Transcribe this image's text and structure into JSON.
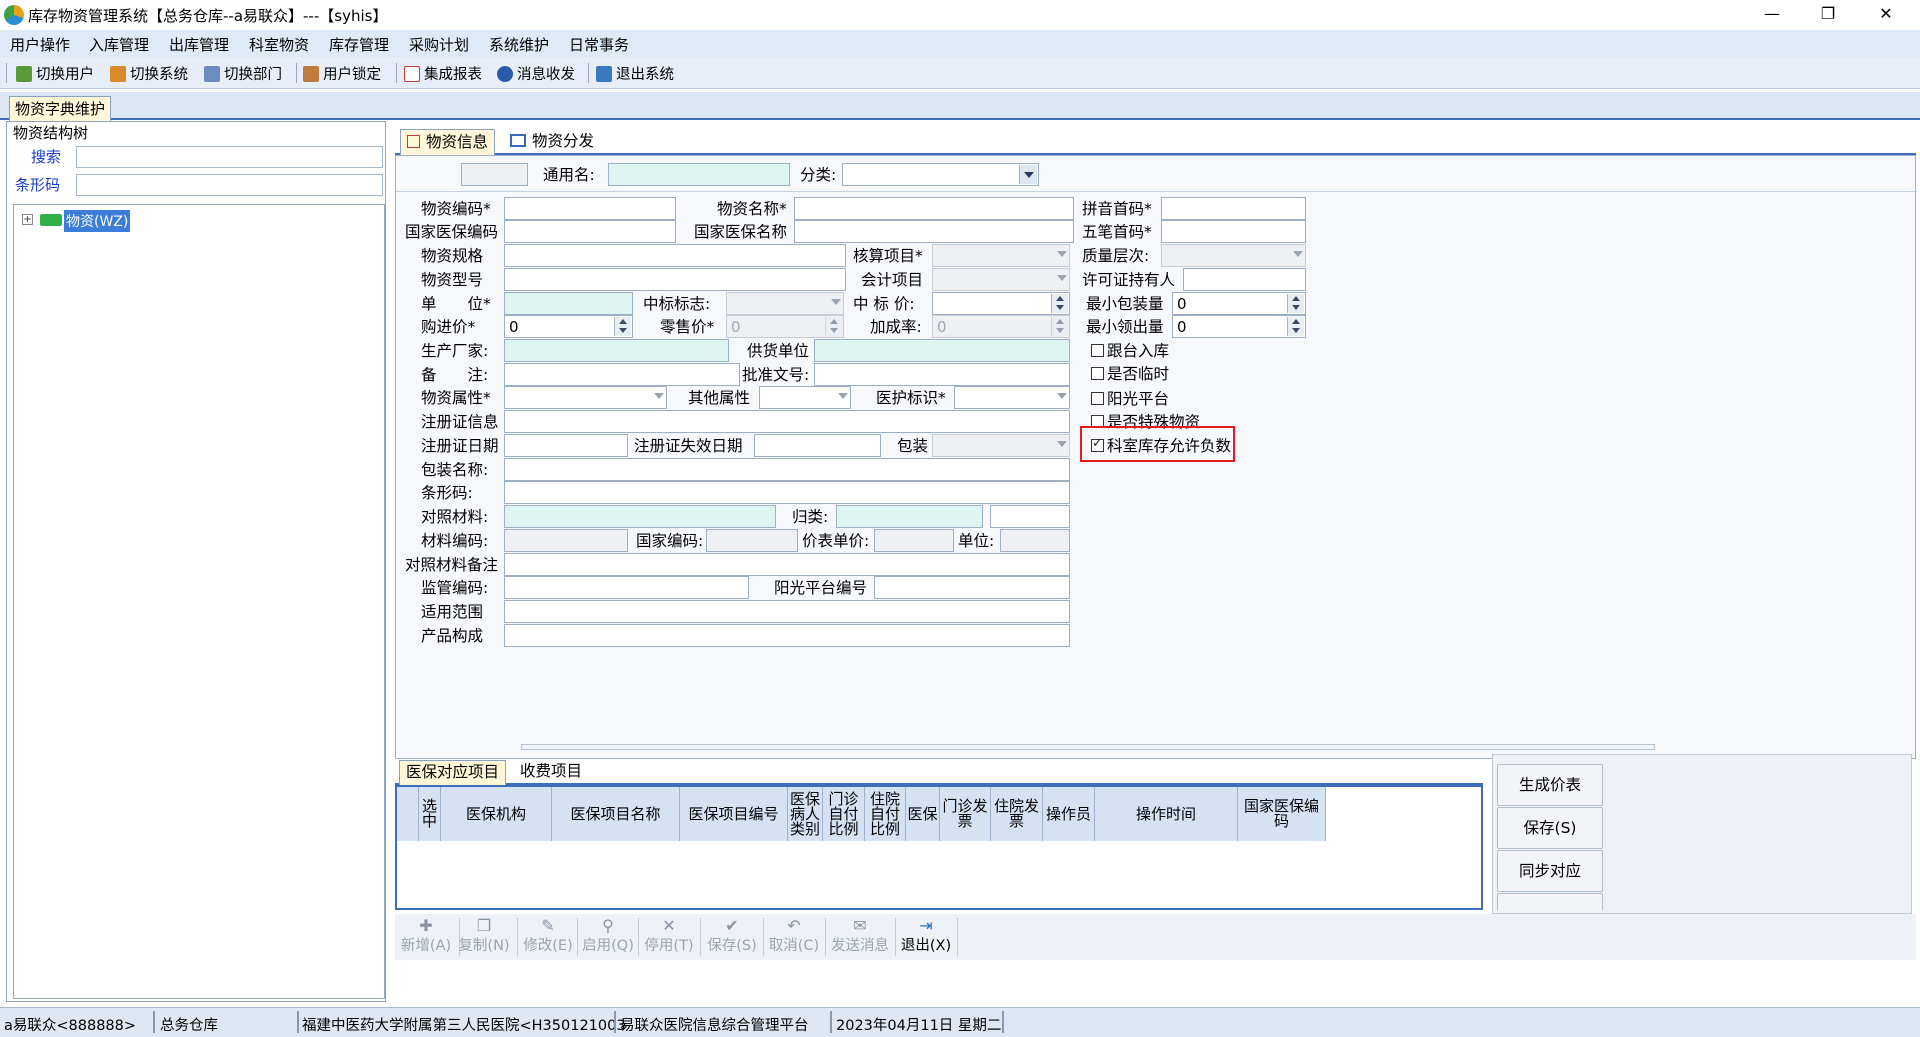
{
  "window": {
    "title": "库存物资管理系统【总务仓库--a易联众】---【syhis】"
  },
  "menu": [
    "用户操作",
    "入库管理",
    "出库管理",
    "科室物资",
    "库存管理",
    "采购计划",
    "系统维护",
    "日常事务"
  ],
  "toolbar": [
    "切换用户",
    "切换系统",
    "切换部门",
    "用户锁定",
    "集成报表",
    "消息收发",
    "退出系统"
  ],
  "main_tab": "物资字典维护",
  "left": {
    "title": "物资结构树",
    "search_label": "搜索",
    "barcode_label": "条形码",
    "tree_root": "物资(WZ)"
  },
  "right_tabs": [
    "物资信息",
    "物资分发"
  ],
  "filter": {
    "generic_name": "通用名:",
    "category": "分类:"
  },
  "labels": {
    "code": "物资编码*",
    "name": "物资名称*",
    "pinyin": "拼音首码*",
    "nhis_code": "国家医保编码",
    "nhis_name": "国家医保名称",
    "wubi": "五笔首码*",
    "spec": "物资规格",
    "accounting": "核算项目*",
    "quality": "质量层次:",
    "model": "物资型号",
    "account_item": "会计项目",
    "license_holder": "许可证持有人",
    "unit": "单　　位*",
    "bid_flag": "中标标志:",
    "bid_price": "中 标 价:",
    "min_pack": "最小包装量",
    "purchase": "购进价*",
    "retail": "零售价*",
    "markup": "加成率:",
    "min_issue": "最小领出量",
    "manufacturer": "生产厂家:",
    "supplier": "供货单位",
    "remark": "备　　注:",
    "approval": "批准文号:",
    "attr": "物资属性*",
    "other_attr": "其他属性",
    "care_mark": "医护标识*",
    "reg_info": "注册证信息",
    "reg_date": "注册证日期",
    "reg_expire": "注册证失效日期",
    "package": "包装",
    "pack_name": "包装名称:",
    "barcode": "条形码:",
    "ref_material": "对照材料:",
    "category2": "归类:",
    "material_code": "材料编码:",
    "national_code": "国家编码:",
    "price_unit": "价表单价:",
    "unit2": "单位:",
    "ref_remark": "对照材料备注",
    "supervise": "监管编码:",
    "sunshine_no": "阳光平台编号",
    "scope": "适用范围",
    "composition": "产品构成"
  },
  "values": {
    "min_pack": "0",
    "purchase": "0",
    "retail": "0",
    "markup": "0",
    "min_issue": "0"
  },
  "checks": [
    {
      "label": "跟台入库",
      "checked": false
    },
    {
      "label": "是否临时",
      "checked": false
    },
    {
      "label": "阳光平台",
      "checked": false
    },
    {
      "label": "是否特殊物资",
      "checked": false
    },
    {
      "label": "科室库存允许负数",
      "checked": true
    }
  ],
  "bottom_tabs": [
    "医保对应项目",
    "收费项目"
  ],
  "grid_headers": [
    "选中",
    "医保机构",
    "医保项目名称",
    "医保项目编号",
    "医保病人类别",
    "门诊自付比例",
    "住院自付比例",
    "医保",
    "门诊发票",
    "住院发票",
    "操作员",
    "操作时间",
    "国家医保编码"
  ],
  "side_buttons": [
    "生成价表",
    "保存(S)",
    "同步对应"
  ],
  "bottom_toolbar": [
    "新增(A)",
    "复制(N)",
    "修改(E)",
    "启用(Q)",
    "停用(T)",
    "保存(S)",
    "取消(C)",
    "发送消息",
    "退出(X)"
  ],
  "status": [
    "a易联众<888888>",
    "总务仓库",
    "福建中医药大学附属第三人民医院<H350121003",
    "易联众医院信息综合管理平台",
    "2023年04月11日 星期二"
  ],
  "colors": {
    "accent": "#3d6fb8",
    "highlight_box": "#e01b24",
    "cyan_field": "#dcf5f0"
  }
}
